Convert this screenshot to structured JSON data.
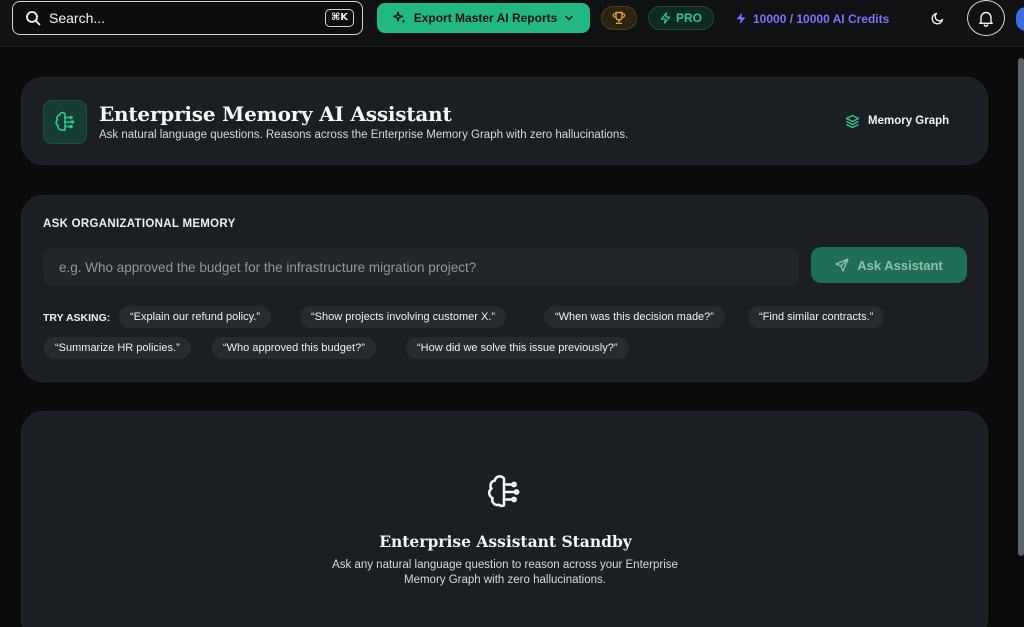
{
  "topbar": {
    "search_label": "Search...",
    "shortcut": "⌘K",
    "export_label": "Export Master AI Reports",
    "pro_label": "PRO",
    "credits_label": "10000 / 10000 AI Credits",
    "colors": {
      "accent": "#22b783",
      "credits": "#7c74ff",
      "pro": "#2fc791"
    }
  },
  "header": {
    "title": "Enterprise Memory AI Assistant",
    "subtitle": "Ask natural language questions. Reasons across the Enterprise Memory Graph with zero hallucinations.",
    "graph_button": "Memory Graph"
  },
  "ask": {
    "section_label": "ASK ORGANIZATIONAL MEMORY",
    "input_placeholder": "e.g. Who approved the budget for the infrastructure migration project?",
    "input_value": "",
    "button_label": "Ask Assistant",
    "try_label": "TRY ASKING:",
    "suggestions": [
      "“Explain our refund policy.”",
      "“Show projects involving customer X.”",
      "“When was this decision made?”",
      "“Find similar contracts.”",
      "“Summarize HR policies.”",
      "“Who approved this budget?”",
      "“How did we solve this issue previously?”"
    ]
  },
  "standby": {
    "title": "Enterprise Assistant Standby",
    "description_line1": "Ask any natural language question to reason across your Enterprise",
    "description_line2": "Memory Graph with zero hallucinations."
  },
  "icons": [
    "search-icon",
    "sparkle-icon",
    "chevron-down-icon",
    "trophy-icon",
    "bolt-icon",
    "moon-icon",
    "bell-icon",
    "brain-icon",
    "layers-icon",
    "send-icon"
  ]
}
